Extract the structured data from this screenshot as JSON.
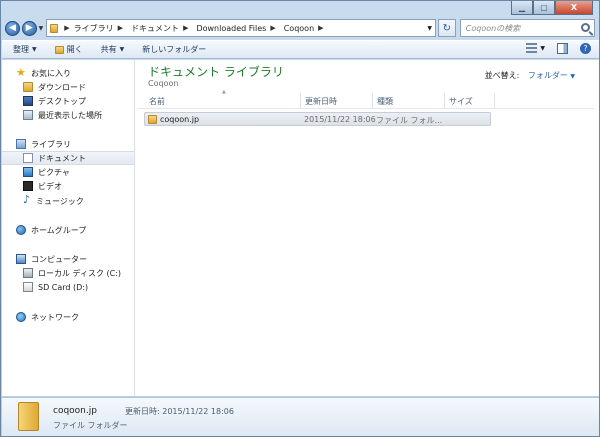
{
  "titlebar": {
    "close_label": "X"
  },
  "address": {
    "crumbs": [
      "ライブラリ",
      "ドキュメント",
      "Downloaded Files",
      "Coqoon"
    ]
  },
  "search": {
    "placeholder": "Coqoonの検索"
  },
  "toolbar": {
    "organize": "整理",
    "open": "開く",
    "share": "共有",
    "new_folder": "新しいフォルダー"
  },
  "sidebar": {
    "favorites": {
      "label": "お気に入り",
      "items": [
        "ダウンロード",
        "デスクトップ",
        "最近表示した場所"
      ]
    },
    "libraries": {
      "label": "ライブラリ",
      "items": [
        "ドキュメント",
        "ピクチャ",
        "ビデオ",
        "ミュージック"
      ]
    },
    "homegroup": {
      "label": "ホームグループ"
    },
    "computer": {
      "label": "コンピューター",
      "items": [
        "ローカル ディスク (C:)",
        "SD Card (D:)"
      ]
    },
    "network": {
      "label": "ネットワーク"
    }
  },
  "content": {
    "title": "ドキュメント ライブラリ",
    "subtitle": "Coqoon",
    "arrange_label": "並べ替え:",
    "arrange_value": "フォルダー",
    "columns": [
      "名前",
      "更新日時",
      "種類",
      "サイズ"
    ],
    "files": [
      {
        "name": "coqoon.jp",
        "modified": "2015/11/22 18:06",
        "type": "ファイル フォル..."
      }
    ]
  },
  "details": {
    "name": "coqoon.jp",
    "modified_label": "更新日時:",
    "modified": "2015/11/22 18:06",
    "type": "ファイル フォルダー"
  }
}
